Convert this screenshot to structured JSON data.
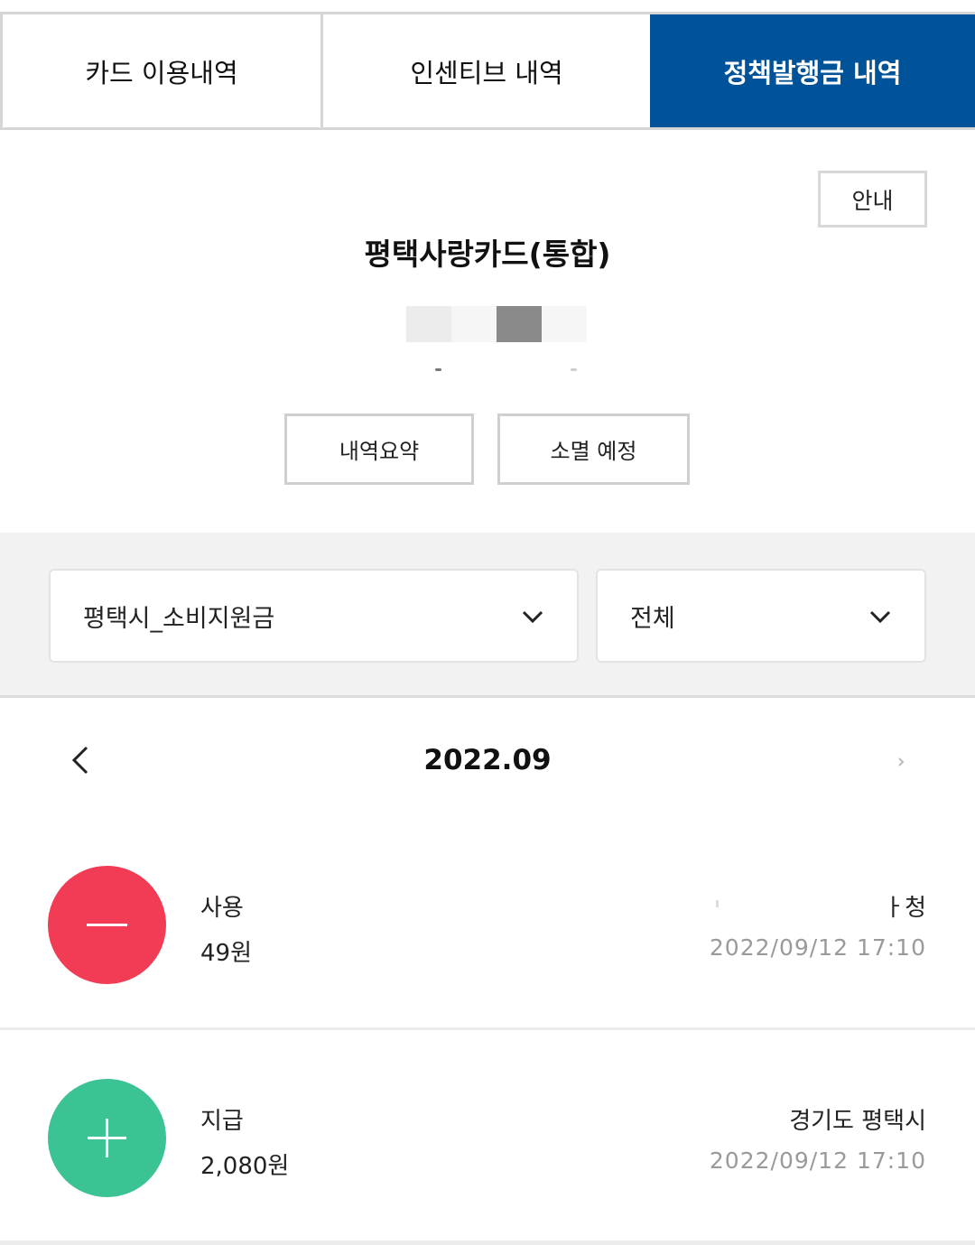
{
  "tabs": [
    {
      "label": "카드 이용내역",
      "active": false
    },
    {
      "label": "인센티브 내역",
      "active": false
    },
    {
      "label": "정책발행금 내역",
      "active": true
    }
  ],
  "header": {
    "info_label": "안내",
    "card_name": "평택사랑카드(통합)"
  },
  "actions": {
    "summary_label": "내역요약",
    "expire_label": "소멸 예정"
  },
  "filters": {
    "policy_select": "평택시_소비지원금",
    "type_select": "전체"
  },
  "month_nav": {
    "month": "2022.09"
  },
  "transactions": [
    {
      "type": "사용",
      "amount": "49원",
      "place": "ㅏ청",
      "datetime": "2022/09/12 17:10",
      "icon": "minus-icon"
    },
    {
      "type": "지급",
      "amount": "2,080원",
      "place": "경기도 평택시",
      "datetime": "2022/09/12 17:10",
      "icon": "plus-icon"
    }
  ],
  "colors": {
    "active_tab": "#005398",
    "use": "#f23c55",
    "grant": "#3cc393",
    "muted_text": "#9a9a9a"
  }
}
